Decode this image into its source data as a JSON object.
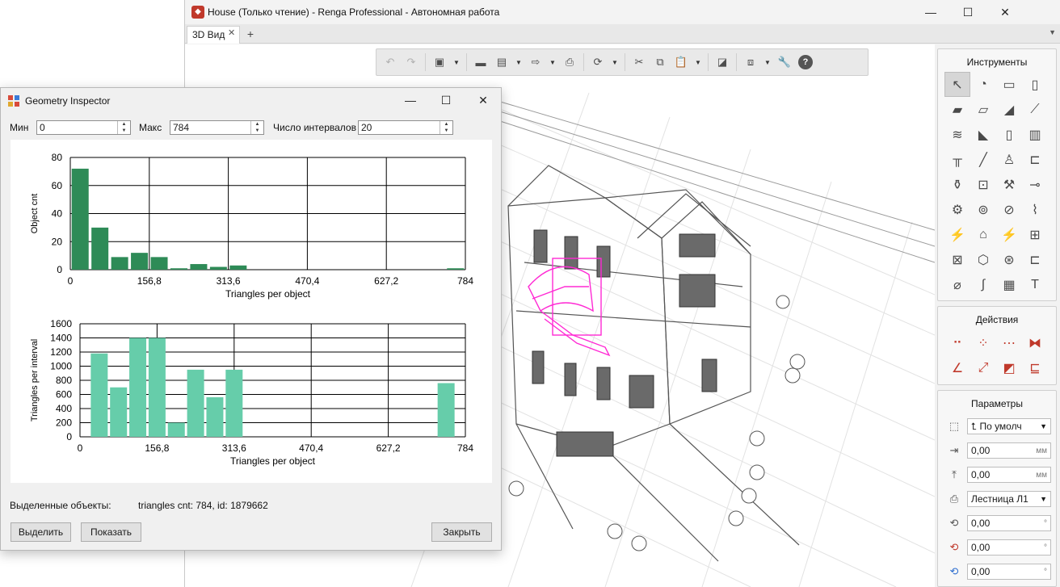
{
  "main_window": {
    "title": "House (Только чтение) - Renga Professional - Автономная работа",
    "app_icon": "renga-logo-icon",
    "minimize": "—",
    "maximize": "☐",
    "close": "✕",
    "tab_label": "3D Вид",
    "tab_close": "✕",
    "tab_add": "+",
    "tab_menu": "▼"
  },
  "toolbar_icons": [
    "undo-icon",
    "redo-icon",
    "view-cube-icon",
    "open-folder-icon",
    "save-icon",
    "export-icon",
    "print-icon",
    "orbit-icon",
    "cut-icon",
    "copy-icon",
    "paste-icon",
    "snapshot-icon",
    "layers-icon",
    "settings-wrench-icon",
    "help-icon"
  ],
  "panels": {
    "tools_title": "Инструменты",
    "actions_title": "Действия",
    "params_title": "Параметры",
    "params": [
      {
        "icon": "align-icon",
        "value": "По умолч",
        "unit": "",
        "dropdown": true,
        "prefix": "⮤"
      },
      {
        "icon": "offset-x-icon",
        "value": "0,00",
        "unit": "мм"
      },
      {
        "icon": "offset-y-icon",
        "value": "0,00",
        "unit": "мм"
      },
      {
        "icon": "style-icon",
        "value": "Лестница Л1",
        "unit": "",
        "dropdown": true
      },
      {
        "icon": "rotate-x-icon",
        "value": "0,00",
        "unit": "°"
      },
      {
        "icon": "rotate-y-icon",
        "value": "0,00",
        "unit": "°"
      },
      {
        "icon": "rotate-z-icon",
        "value": "0,00",
        "unit": "°"
      }
    ]
  },
  "dialog": {
    "title": "Geometry Inspector",
    "min_label": "Мин",
    "min_value": "0",
    "max_label": "Макс",
    "max_value": "784",
    "intervals_label": "Число интервалов",
    "intervals_value": "20",
    "selected_label": "Выделенные объекты:",
    "selected_value": "triangles cnt: 784, id: 1879662",
    "btn_select": "Выделить",
    "btn_show": "Показать",
    "btn_close": "Закрыть"
  },
  "chart_data": [
    {
      "type": "bar",
      "xlabel": "Triangles per object",
      "ylabel": "Object cnt",
      "xlim": [
        0,
        784
      ],
      "ylim": [
        0,
        80
      ],
      "xticks": [
        "0",
        "156,8",
        "313,6",
        "470,4",
        "627,2",
        "784"
      ],
      "yticks": [
        "0",
        "20",
        "40",
        "60",
        "80"
      ],
      "color": "#2e8b57",
      "bin_centers": [
        19.6,
        58.8,
        98.0,
        137.2,
        176.4,
        215.6,
        254.8,
        294.0,
        333.2,
        372.4,
        411.6,
        450.8,
        490.0,
        529.2,
        568.4,
        607.6,
        646.8,
        686.0,
        725.2,
        764.4
      ],
      "values": [
        72,
        30,
        9,
        12,
        9,
        1,
        4,
        2,
        3,
        0,
        0,
        0,
        0,
        0,
        0,
        0,
        0,
        0,
        0,
        1
      ]
    },
    {
      "type": "bar",
      "xlabel": "Triangles per object",
      "ylabel": "Triangles per interval",
      "xlim": [
        0,
        784
      ],
      "ylim": [
        0,
        1600
      ],
      "xticks": [
        "0",
        "156,8",
        "313,6",
        "470,4",
        "627,2",
        "784"
      ],
      "yticks": [
        "0",
        "200",
        "400",
        "600",
        "800",
        "1000",
        "1200",
        "1400",
        "1600"
      ],
      "color": "#66cdaa",
      "bin_centers": [
        39.2,
        78.4,
        117.6,
        156.8,
        196.0,
        235.2,
        274.4,
        313.6,
        352.8,
        392.0,
        431.2,
        470.4,
        509.6,
        548.8,
        588.0,
        627.2,
        666.4,
        705.6,
        744.8,
        784.0
      ],
      "values": [
        1180,
        700,
        1400,
        1400,
        200,
        950,
        560,
        950,
        0,
        0,
        0,
        0,
        0,
        0,
        0,
        0,
        0,
        0,
        760,
        0
      ]
    }
  ]
}
